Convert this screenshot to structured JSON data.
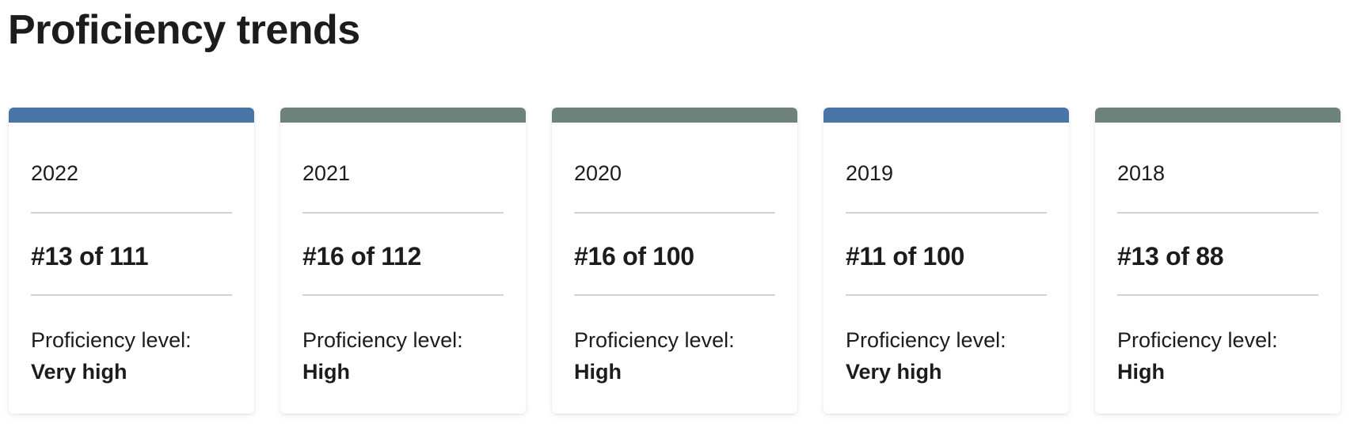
{
  "page": {
    "title": "Proficiency trends"
  },
  "colors": {
    "very_high": "#4874a8",
    "high": "#6d827b"
  },
  "cards": [
    {
      "year": "2022",
      "rank": "#13 of 111",
      "level_label": "Proficiency level:",
      "level_value": "Very high",
      "bar_color": "#4874a8"
    },
    {
      "year": "2021",
      "rank": "#16 of 112",
      "level_label": "Proficiency level:",
      "level_value": "High",
      "bar_color": "#6d827b"
    },
    {
      "year": "2020",
      "rank": "#16 of 100",
      "level_label": "Proficiency level:",
      "level_value": "High",
      "bar_color": "#6d827b"
    },
    {
      "year": "2019",
      "rank": "#11 of 100",
      "level_label": "Proficiency level:",
      "level_value": "Very high",
      "bar_color": "#4874a8"
    },
    {
      "year": "2018",
      "rank": "#13 of 88",
      "level_label": "Proficiency level:",
      "level_value": "High",
      "bar_color": "#6d827b"
    }
  ]
}
